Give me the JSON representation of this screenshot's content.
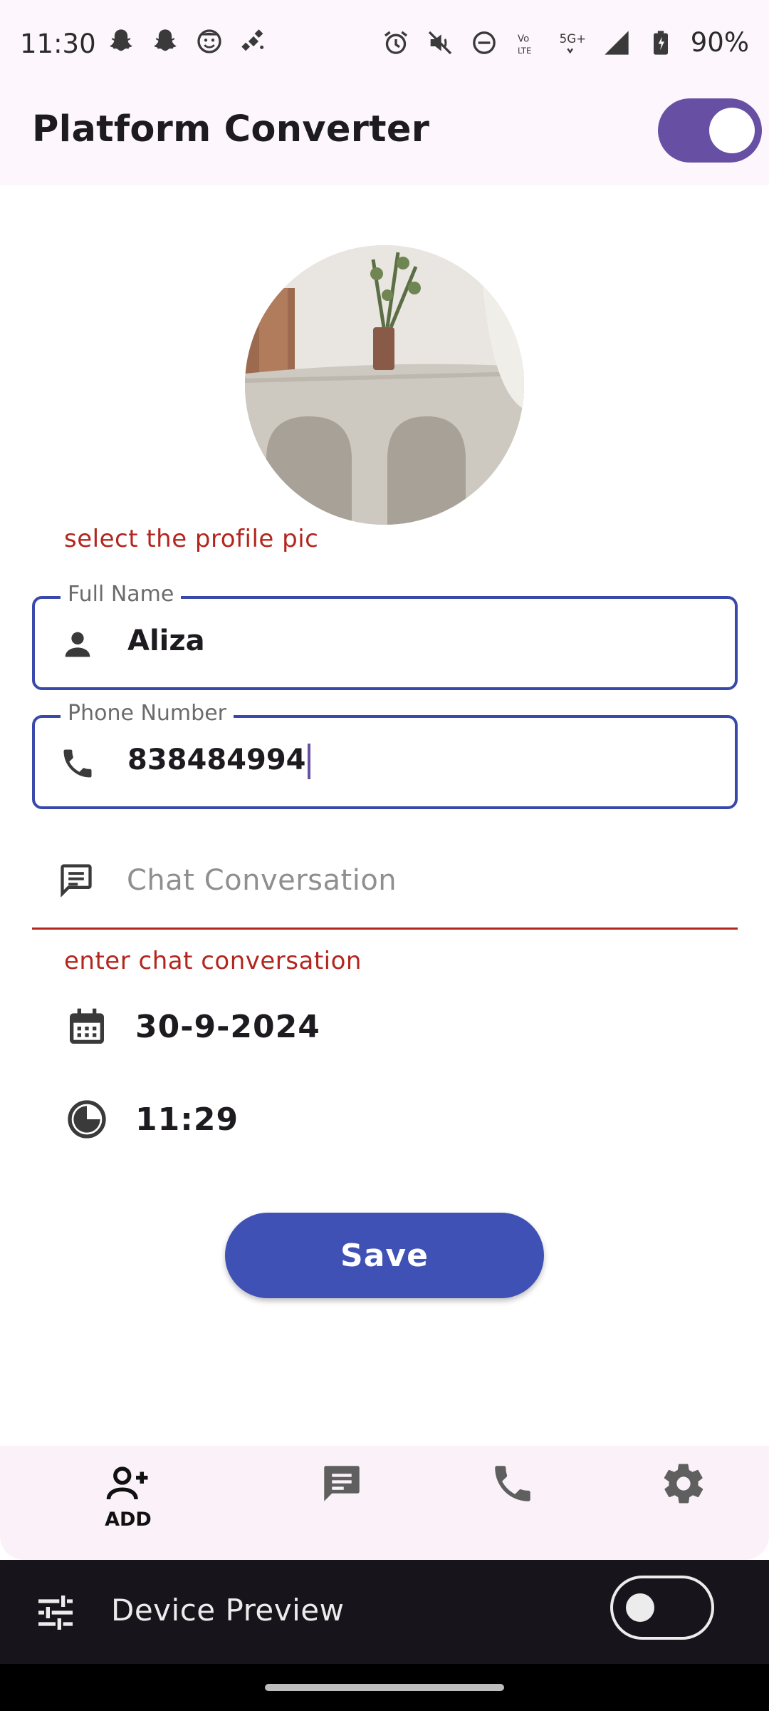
{
  "status_bar": {
    "time": "11:30",
    "battery": "90%",
    "left_icons": [
      "snapchat-icon",
      "snapchat-icon",
      "face-icon",
      "satellite-icon"
    ],
    "right_icons": [
      "alarm-icon",
      "mute-icon",
      "dnd-icon",
      "volte-icon",
      "5g-icon",
      "signal-icon",
      "battery-icon"
    ]
  },
  "app_bar": {
    "title": "Platform Converter",
    "toggle_on": true
  },
  "profile": {
    "error": "select the profile pic"
  },
  "fields": {
    "full_name": {
      "label": "Full Name",
      "value": "Aliza",
      "icon": "person-icon"
    },
    "phone": {
      "label": "Phone Number",
      "value": "838484994",
      "icon": "phone-icon"
    },
    "chat": {
      "placeholder": "Chat Conversation",
      "error": "enter chat conversation",
      "icon": "chat-icon"
    }
  },
  "date": {
    "value": "30-9-2024",
    "icon": "calendar-icon"
  },
  "time": {
    "value": "11:29",
    "icon": "clock-icon"
  },
  "save_label": "Save",
  "bottom_nav": {
    "items": [
      {
        "label": "ADD",
        "icon": "person-add-icon",
        "active": true
      },
      {
        "label": "",
        "icon": "chat-icon",
        "active": false
      },
      {
        "label": "",
        "icon": "phone-icon",
        "active": false
      },
      {
        "label": "",
        "icon": "settings-icon",
        "active": false
      }
    ]
  },
  "device_preview": {
    "title": "Device Preview",
    "toggle_on": false
  },
  "colors": {
    "accent": "#6750a4",
    "field_border": "#3949ab",
    "error": "#b3261e",
    "save_button": "#3f51b5"
  }
}
